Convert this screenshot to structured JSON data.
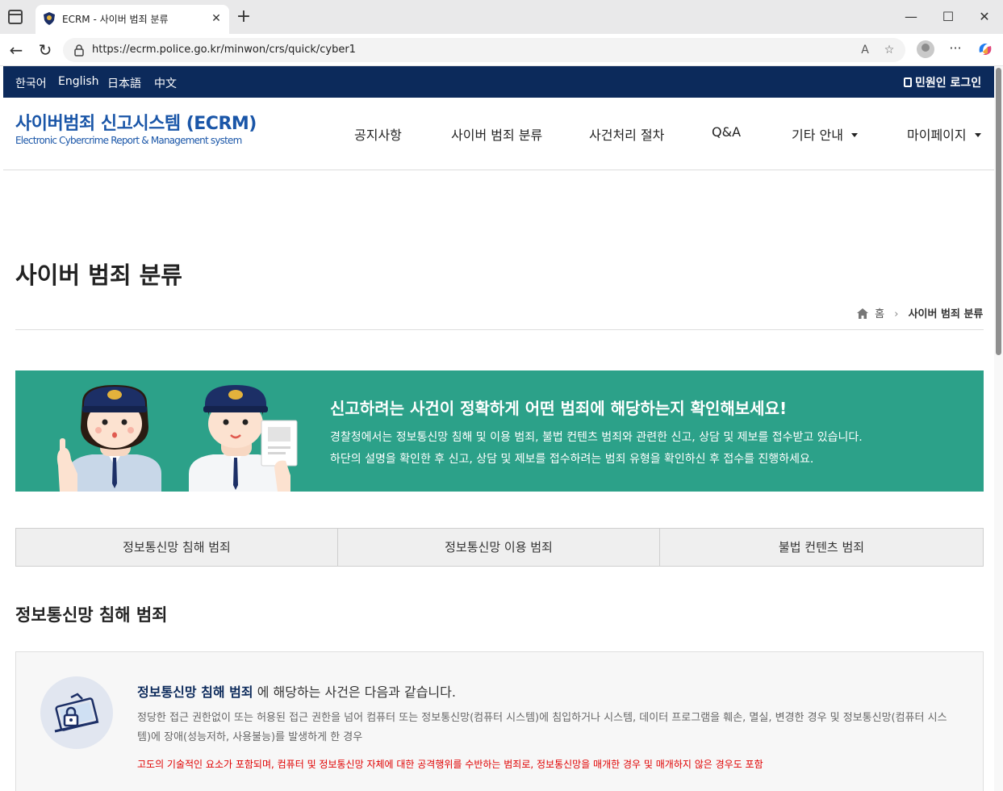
{
  "browser": {
    "tab_title": "ECRM - 사이버 범죄 분류",
    "url": "https://ecrm.police.go.kr/minwon/crs/quick/cyber1"
  },
  "topbar": {
    "languages": [
      "한국어",
      "English",
      "日本語",
      "中文"
    ],
    "login": "민원인 로그인"
  },
  "header": {
    "logo_title": "사이버범죄 신고시스템 (ECRM)",
    "logo_sub": "Electronic Cybercrime Report & Management system",
    "nav": [
      "공지사항",
      "사이버 범죄 분류",
      "사건처리 절차",
      "Q&A",
      "기타 안내",
      "마이페이지"
    ]
  },
  "page": {
    "title": "사이버 범죄 분류",
    "breadcrumb_home": "홈",
    "breadcrumb_current": "사이버 범죄 분류"
  },
  "banner": {
    "headline": "신고하려는 사건이 정확하게 어떤 범죄에 해당하는지 확인해보세요!",
    "line1": "경찰청에서는 정보통신망 침해 및 이용 범죄, 불법 컨텐츠 범죄와 관련한 신고, 상담 및 제보를 접수받고 있습니다.",
    "line2": "하단의 설명을 확인한 후 신고, 상담 및 제보를 접수하려는 범죄 유형을 확인하신 후 접수를 진행하세요."
  },
  "category_tabs": [
    "정보통신망 침해 범죄",
    "정보통신망 이용 범죄",
    "불법 컨텐츠 범죄"
  ],
  "section": {
    "title": "정보통신망 침해 범죄",
    "head_strong": "정보통신망 침해 범죄",
    "head_rest": " 에 해당하는 사건은 다음과 같습니다.",
    "description": "정당한 접근 권한없이 또는 허용된 접근 권한을 넘어 컴퓨터 또는 정보통신망(컴퓨터 시스템)에 침입하거나 시스템, 데이터 프로그램을 훼손, 멸실, 변경한 경우 및 정보통신망(컴퓨터 시스템)에 장애(성능저하, 사용불능)를 발생하게 한 경우",
    "warning": "고도의 기술적인 요소가 포함되며, 컴퓨터 및 정보통신망 자체에 대한 공격행위를 수반하는 범죄로, 정보통신망을 매개한 경우 및 매개하지 않은 경우도 포함"
  },
  "colors": {
    "topbar": "#0c2a5b",
    "logo": "#1a56a8",
    "banner": "#2ca189",
    "warning": "#e00000"
  }
}
